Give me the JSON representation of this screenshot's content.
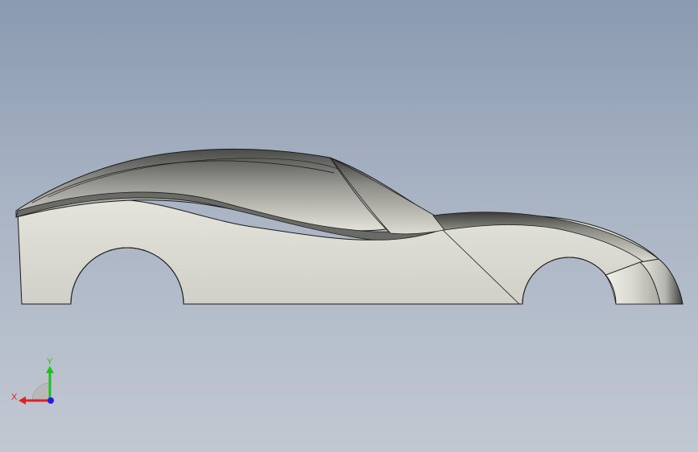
{
  "viewport": {
    "background_top": "#8a9ab0",
    "background_bottom": "#c2c8d2"
  },
  "model": {
    "name": "car-body-side-view",
    "face_color": "#d6d6cf",
    "edge_color": "#1a1a1a"
  },
  "triad": {
    "x_label": "X",
    "y_label": "Y",
    "x_color": "#e02020",
    "y_color": "#20c020",
    "z_color": "#2020e0"
  }
}
